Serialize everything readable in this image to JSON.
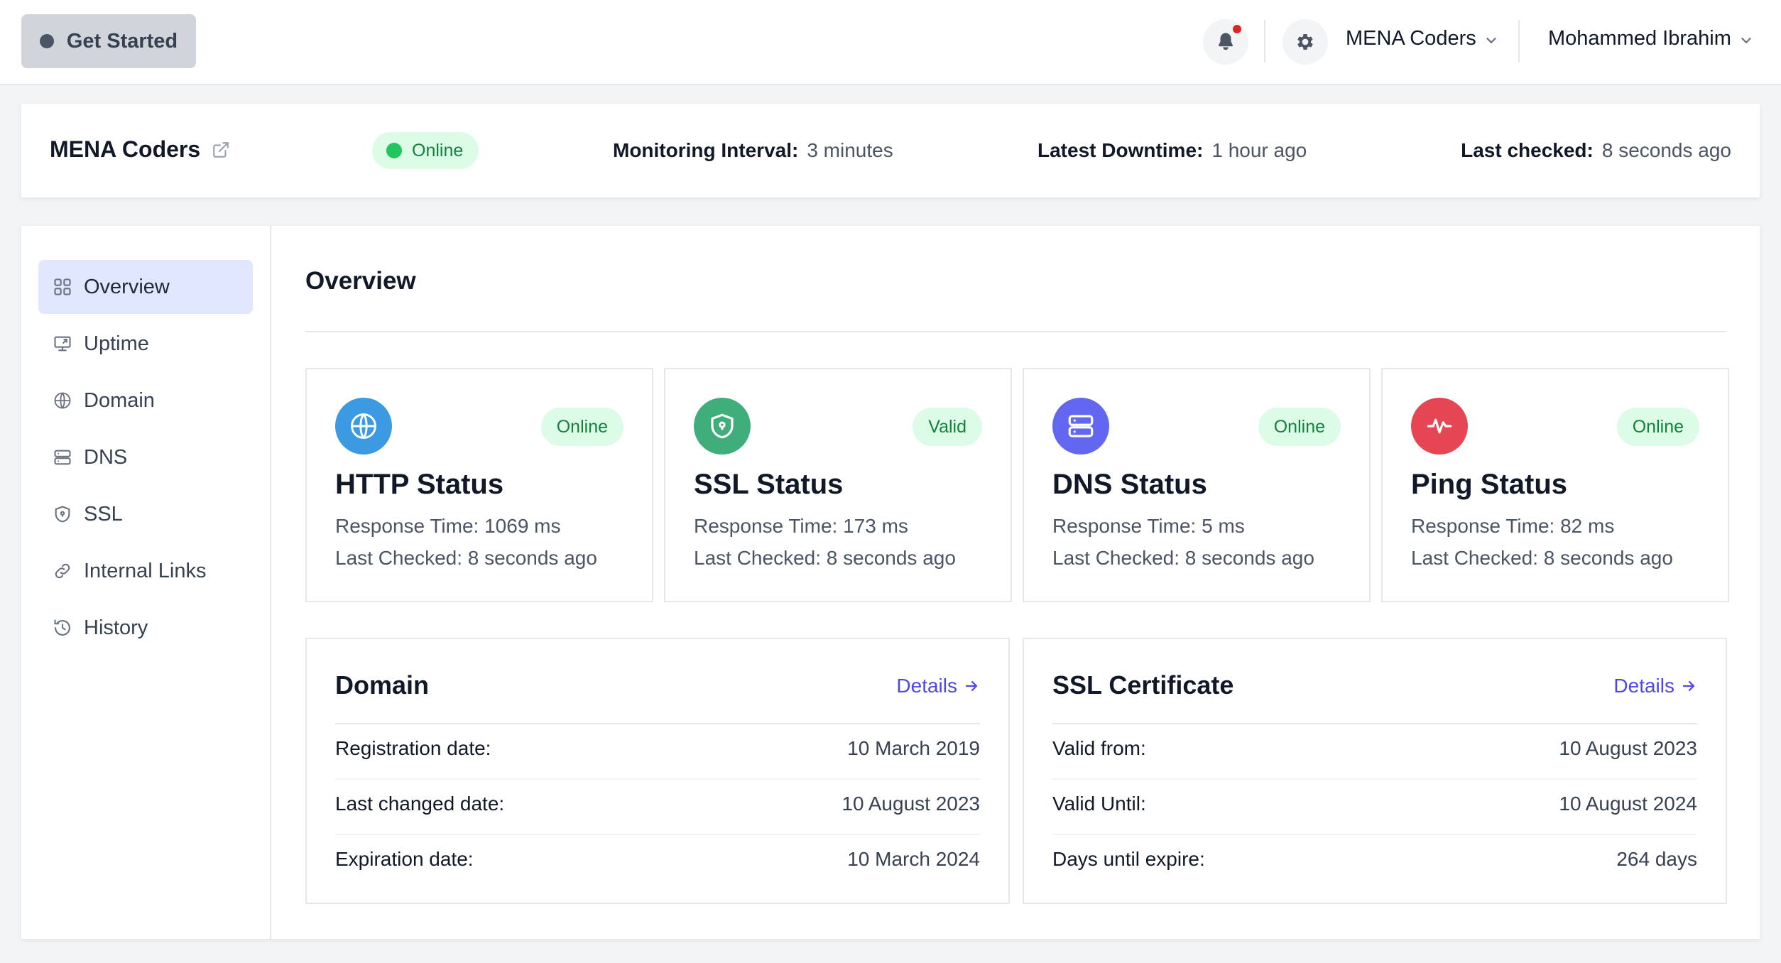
{
  "topbar": {
    "get_started_label": "Get Started",
    "organization": "MENA Coders",
    "user": "Mohammed Ibrahim",
    "notification_dot_color": "#dc2626"
  },
  "monitor": {
    "name": "MENA Coders",
    "status": "Online",
    "interval_label": "Monitoring Interval:",
    "interval_value": "3 minutes",
    "downtime_label": "Latest Downtime:",
    "downtime_value": "1 hour ago",
    "checked_label": "Last checked:",
    "checked_value": "8 seconds ago"
  },
  "sidebar": {
    "items": [
      {
        "label": "Overview",
        "icon": "grid-icon",
        "active": true
      },
      {
        "label": "Uptime",
        "icon": "monitor-icon"
      },
      {
        "label": "Domain",
        "icon": "www-globe-icon"
      },
      {
        "label": "DNS",
        "icon": "server-icon"
      },
      {
        "label": "SSL",
        "icon": "shield-icon"
      },
      {
        "label": "Internal Links",
        "icon": "link-icon"
      },
      {
        "label": "History",
        "icon": "history-icon"
      }
    ]
  },
  "overview": {
    "title": "Overview",
    "status_cards": [
      {
        "title": "HTTP Status",
        "badge": "Online",
        "response": "Response Time: 1069 ms",
        "checked": "Last Checked: 8 seconds ago",
        "icon": "globe-icon",
        "color": "#3b9ae1"
      },
      {
        "title": "SSL Status",
        "badge": "Valid",
        "response": "Response Time: 173 ms",
        "checked": "Last Checked: 8 seconds ago",
        "icon": "shield-lock-icon",
        "color": "#3fae7a"
      },
      {
        "title": "DNS Status",
        "badge": "Online",
        "response": "Response Time: 5 ms",
        "checked": "Last Checked: 8 seconds ago",
        "icon": "server-icon",
        "color": "#6366f1"
      },
      {
        "title": "Ping Status",
        "badge": "Online",
        "response": "Response Time: 82 ms",
        "checked": "Last Checked: 8 seconds ago",
        "icon": "pulse-icon",
        "color": "#e64553"
      }
    ],
    "domain": {
      "title": "Domain",
      "details_label": "Details",
      "rows": [
        {
          "label": "Registration date:",
          "value": "10 March 2019"
        },
        {
          "label": "Last changed date:",
          "value": "10 August 2023"
        },
        {
          "label": "Expiration date:",
          "value": "10 March 2024"
        }
      ]
    },
    "ssl": {
      "title": "SSL Certificate",
      "details_label": "Details",
      "rows": [
        {
          "label": "Valid from:",
          "value": "10 August 2023"
        },
        {
          "label": "Valid Until:",
          "value": "10 August 2024"
        },
        {
          "label": "Days until expire:",
          "value": "264 days"
        }
      ]
    }
  }
}
